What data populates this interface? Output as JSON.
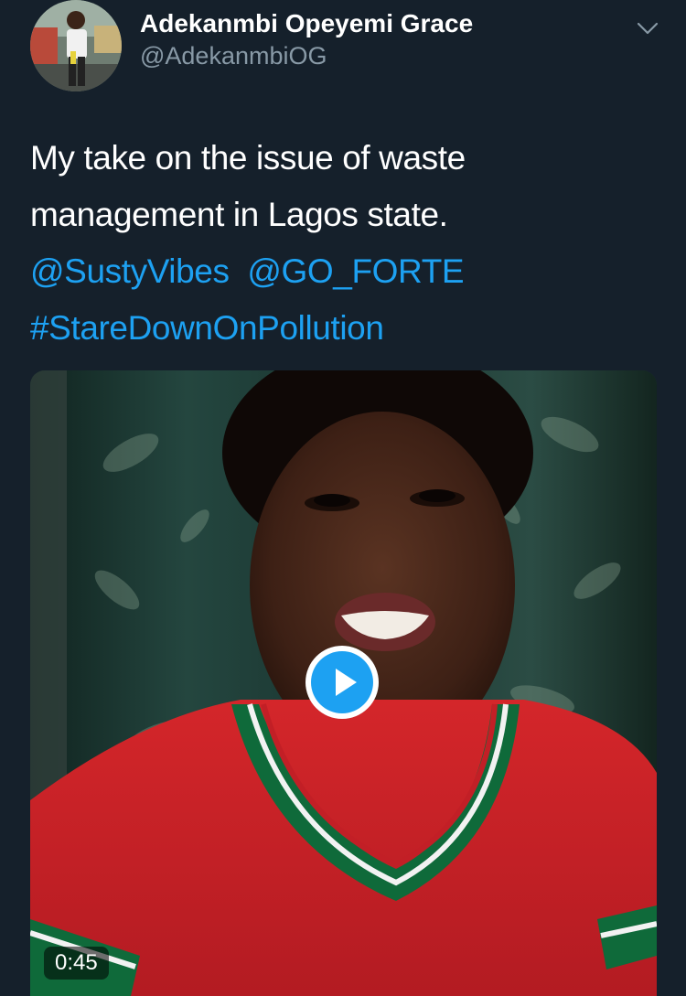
{
  "colors": {
    "background": "#15202b",
    "name_text": "#ffffff",
    "handle_text": "#8899a6",
    "link": "#1da1f2",
    "play_button": "#1da1f2"
  },
  "author": {
    "name": "Adekanmbi Opeyemi Grace",
    "handle": "@AdekanmbiOG",
    "avatar_icon": "profile-photo"
  },
  "menu": {
    "icon": "chevron-down-icon"
  },
  "tweet": {
    "text_line_1": "My take on the issue of waste",
    "text_line_2": "management in Lagos state.",
    "mention_1": "@SustyVibes",
    "mention_2": "@GO_FORTE",
    "hashtag": "#StareDownOnPollution"
  },
  "media": {
    "type": "video",
    "play_icon": "play-icon",
    "duration": "0:45"
  }
}
